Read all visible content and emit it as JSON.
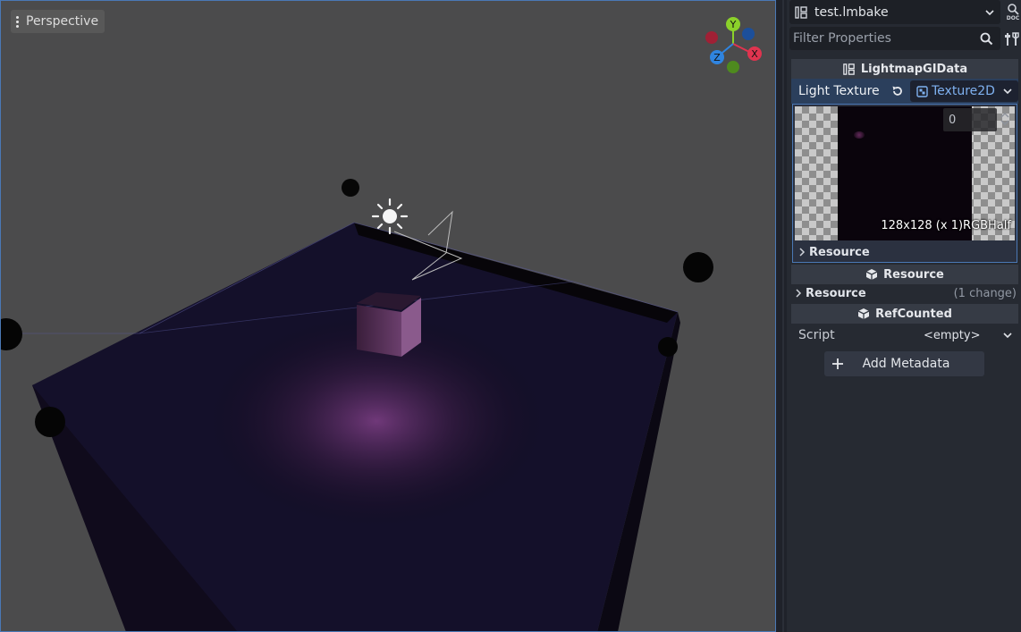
{
  "viewport": {
    "view_label": "Perspective",
    "gizmo_axes": {
      "y": "Y",
      "x": "X",
      "z": "Z"
    },
    "colors": {
      "axis_x": "#e0344f",
      "axis_y": "#8bd12a",
      "axis_z": "#2f84e0"
    }
  },
  "inspector": {
    "resource_name": "test.lmbake",
    "filter_placeholder": "Filter Properties",
    "class_header": "LightmapGIData",
    "light_texture": {
      "label": "Light Texture",
      "type": "Texture2D",
      "layer_value": "0",
      "info": "128x128 (x 1)RGBHalf",
      "sub_section": "Resource"
    },
    "resource_header": "Resource",
    "resource_prop": {
      "label": "Resource",
      "changes": "(1 change)"
    },
    "refcounted_header": "RefCounted",
    "script_prop": {
      "label": "Script",
      "value": "<empty>"
    },
    "add_metadata": "Add Metadata"
  }
}
